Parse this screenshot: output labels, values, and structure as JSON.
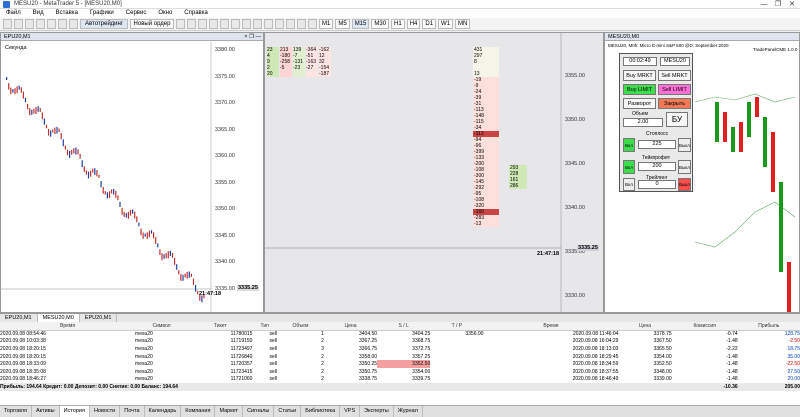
{
  "window": {
    "title": "MESU20 - MetaTrader 5 - [MESU20,M0]",
    "controls": [
      "—",
      "❐",
      "✕"
    ]
  },
  "menu": [
    "Файл",
    "Вид",
    "Вставка",
    "Графики",
    "Сервис",
    "Окно",
    "Справка"
  ],
  "toolbar": {
    "autotrade": "Автотрейдинг",
    "neworder": "Новый ордер",
    "timeframes": [
      "M1",
      "M5",
      "M15",
      "M30",
      "H1",
      "H4",
      "D1",
      "W1",
      "MN"
    ]
  },
  "chart1": {
    "title": "EPU20,M1",
    "label": "Секунда",
    "yticks": [
      "3380.00",
      "3375.00",
      "3370.00",
      "3365.00",
      "3360.00",
      "3355.00",
      "3350.00",
      "3345.00",
      "3340.00",
      "3335.00"
    ],
    "price": "3335.25",
    "time": "21:47:18"
  },
  "chart2": {
    "title": "MESU20,M0",
    "yticks": [
      "3355.00",
      "3350.00",
      "3345.00",
      "3340.00",
      "3335.00",
      "3330.00"
    ],
    "price": "3335.25",
    "time": "21:47:18",
    "ladderA": [
      [
        "23",
        "213",
        "139",
        "-364",
        "-162"
      ],
      [
        "4",
        "-180",
        "-7",
        "-51",
        "12"
      ],
      [
        "9",
        "-258",
        "-131",
        "-163",
        "32"
      ],
      [
        "2",
        "-5",
        "-23",
        "-27",
        "-154"
      ],
      [
        "20",
        "",
        "",
        "",
        "-187"
      ]
    ],
    "ladderB": [
      "431",
      "297",
      "8",
      "",
      "13",
      "-19",
      "-9",
      "-24",
      "-39",
      "-31",
      "-113",
      "-148",
      "-115",
      "-34",
      "-113",
      "-94",
      "-96",
      "-399",
      "-133",
      "-200",
      "-108",
      "293",
      "228",
      "161",
      "286",
      "-300",
      "-145",
      "-292",
      "-95",
      "-108",
      "-320",
      "-160",
      "-283",
      "-13"
    ]
  },
  "chart3": {
    "title": "MESU20,M0",
    "info": "MESU20, M0h: Micro E-mini S&P 500 @D: September 2020",
    "brand": "TradePanelCME 1.0.0",
    "yticks": []
  },
  "panel": {
    "time": "00:02:49",
    "symbol": "MESU20",
    "buymkt": "Buy MRKT",
    "sellmkt": "Sell MRKT",
    "buylimit": "Buy LIMIT",
    "selllimit": "Sell LIMIT",
    "reverse": "Разворот",
    "close": "Закрыть",
    "volume_label": "Объем",
    "volume": "2.00",
    "bu": "БУ",
    "sl_label": "Стоплосс",
    "sl": "225",
    "tp_label": "Тейкпрофит",
    "tp": "200",
    "trail_label": "Трейлинг",
    "trail": "0",
    "on": "Вкл",
    "off": "Выкл"
  },
  "tabs": [
    "EPU20,M1",
    "MESU20,M0",
    "EPU20,M1"
  ],
  "table": {
    "headers": [
      "Время",
      "Символ",
      "Тикет",
      "Тип",
      "Объем",
      "Цена",
      "S / L",
      "T / P",
      "Время",
      "Цена",
      "Комиссия",
      "Прибыль"
    ],
    "rows": [
      [
        "2020.09.08 08:54:46",
        "mesu20",
        "11780015",
        "sell",
        "1",
        "3404.50",
        "3404.25",
        "3356.00",
        "2020.09.08 11:46:04",
        "3378.75",
        "-0.74",
        "128.75"
      ],
      [
        "2020.09.08 10:03:38",
        "mesu20",
        "11719150",
        "sell",
        "2",
        "3367.25",
        "3368.75",
        "",
        "2020.09.08 16:04:29",
        "3367.50",
        "-1.48",
        "-2.50"
      ],
      [
        "2020.09.08 18:20:15",
        "mesu20",
        "11723497",
        "sell",
        "3",
        "3366.75",
        "3372.75",
        "",
        "2020.09.08 18:13:03",
        "3365.50",
        "-2.22",
        "18.75"
      ],
      [
        "2020.09.08 18:20:15",
        "mesu20",
        "11726840",
        "sell",
        "2",
        "3358.00",
        "3357.25",
        "",
        "2020.09.08 18:29:45",
        "3354.00",
        "-1.48",
        "35.00"
      ],
      [
        "2020.09.08 18:33:09",
        "mesu20",
        "11720357",
        "sell",
        "2",
        "3350.25",
        "3352.50",
        "",
        "2020.09.08 18:34:59",
        "3352.50",
        "-1.48",
        "-22.50"
      ],
      [
        "2020.09.08 18:35:08",
        "mesu20",
        "11723415",
        "sell",
        "2",
        "3350.75",
        "3354.00",
        "",
        "2020.09.08 18:37:55",
        "3348.00",
        "-1.48",
        "27.50"
      ],
      [
        "2020.09.08 18:46:27",
        "mesu20",
        "11721060",
        "sell",
        "2",
        "3338.75",
        "3339.75",
        "",
        "2020.09.08 18:46:49",
        "3339.00",
        "-1.48",
        "20.00"
      ]
    ],
    "total": "Прибыль: 194.64  Кредит: 0.00  Депозит: 0.00  Снятие: 0.00  Баланс: 194.64",
    "total_comm": "-10.36",
    "total_profit": "205.00"
  },
  "btabs": [
    "Торговля",
    "Активы",
    "История",
    "Новости",
    "Почта",
    "Календарь",
    "Компания",
    "Маркет",
    "Сигналы",
    "Статьи",
    "Библиотека",
    "VPS",
    "Эксперты",
    "Журнал"
  ]
}
